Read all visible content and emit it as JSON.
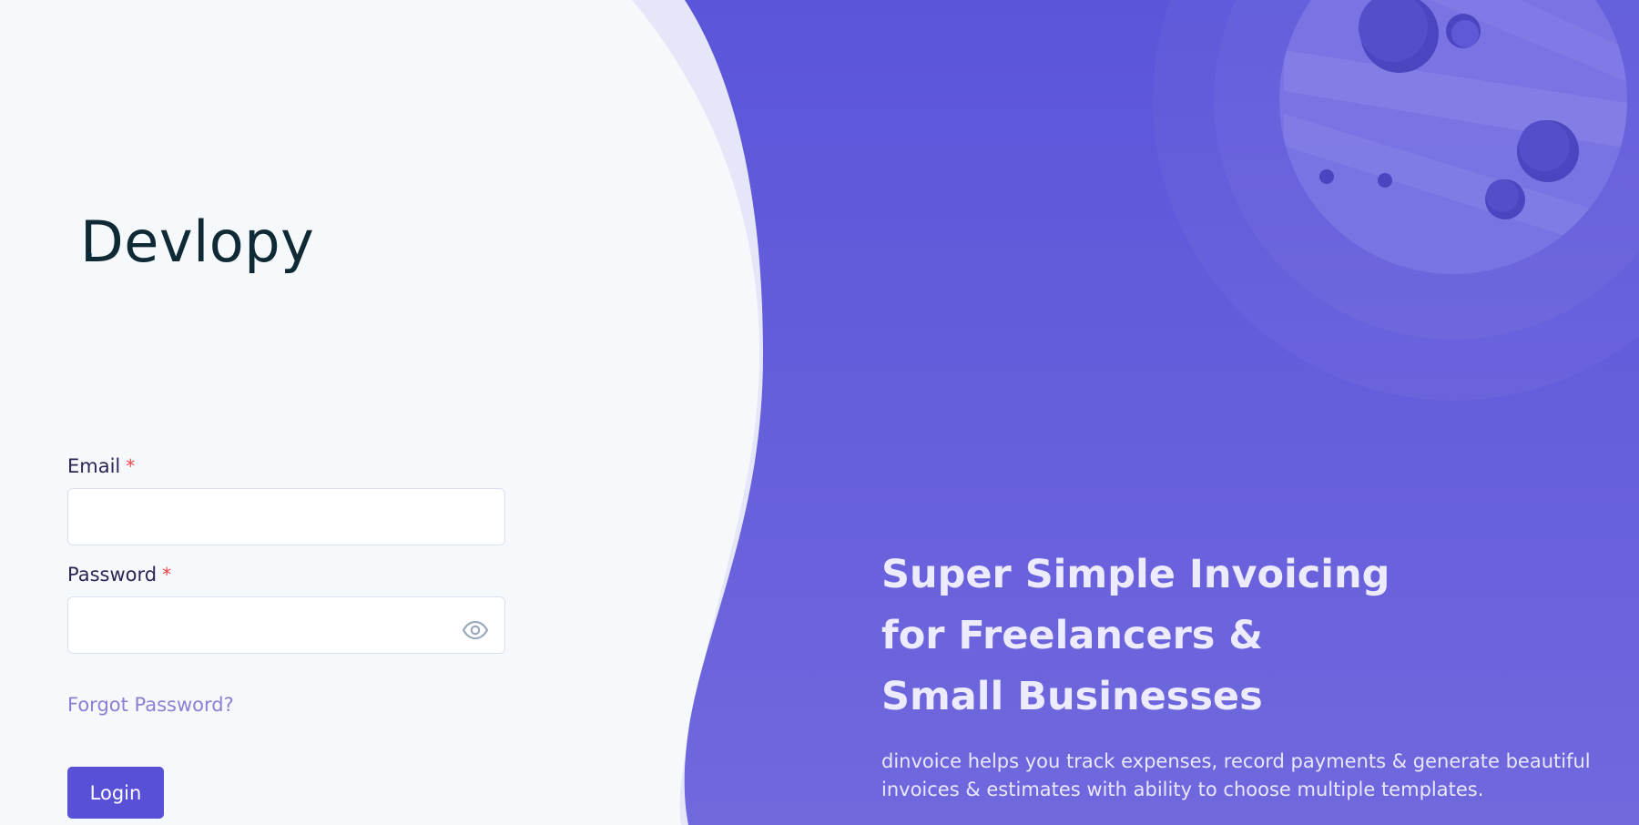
{
  "brand": {
    "logo_text": "Devlopy"
  },
  "login_form": {
    "email": {
      "label": "Email",
      "required_mark": "*",
      "value": "",
      "placeholder": ""
    },
    "password": {
      "label": "Password",
      "required_mark": "*",
      "value": "",
      "placeholder": ""
    },
    "forgot_password_label": "Forgot Password?",
    "login_button_label": "Login"
  },
  "hero": {
    "title_lines": [
      "Super Simple Invoicing",
      "for Freelancers &",
      "Small Businesses"
    ],
    "description": "dinvoice helps you track expenses, record payments & generate beautiful invoices & estimates with ability to choose multiple templates."
  },
  "icons": {
    "password_toggle": "eye-icon"
  },
  "colors": {
    "page_background": "#f6f9fb",
    "panel_background_top": "#5b55d9",
    "panel_background_bottom": "#7068dd",
    "accent": "#5851d8",
    "required": "#ef4444",
    "link": "#8b7fd6",
    "heading_text": "#ecebff"
  }
}
